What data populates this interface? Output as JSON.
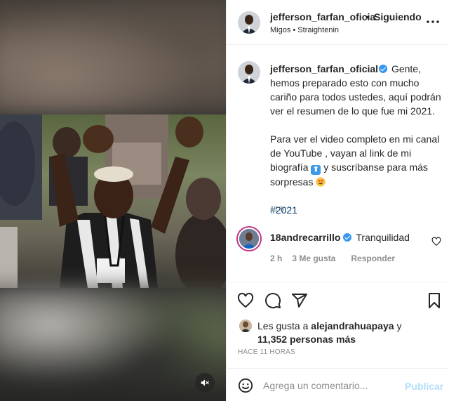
{
  "header": {
    "username": "jefferson_farfan_oficia",
    "separator": "•",
    "follow_status": "Siguiendo",
    "audio_label": "Migos • Straightenin"
  },
  "post": {
    "caption_username": "jefferson_farfan_oficial",
    "caption_line1": "Gente, hemos preparado esto con mucho cariño para todos ustedes, aquí podrán ver el resumen de lo que fue mi 2021.",
    "caption_line2a": "Para ver el video completo en mi canal de YouTube , vayan al link de mi biografía",
    "caption_line2b": "y suscríbanse para más sorpresas",
    "hashtag": "#2021",
    "time": "11 h"
  },
  "comment": {
    "username": "18andrecarrillo",
    "text": "Tranquilidad",
    "time": "2 h",
    "likes": "3 Me gusta",
    "reply": "Responder"
  },
  "likes": {
    "prefix": "Les gusta a",
    "user": "alejandrahuapaya",
    "connector": "y",
    "count": "11,352 personas más"
  },
  "posted_ago": "HACE 11 HORAS",
  "comment_input": {
    "placeholder": "Agrega un comentario...",
    "publish": "Publicar"
  },
  "icons": [
    "more-icon",
    "verified-icon",
    "heart-icon",
    "comment-icon",
    "share-icon",
    "save-icon",
    "emoji-icon",
    "mute-icon"
  ],
  "colors": {
    "verified": "#3897f0",
    "hashtag": "#00376b",
    "publish_disabled": "#b2dffc",
    "muted_text": "#8e8e8e"
  }
}
